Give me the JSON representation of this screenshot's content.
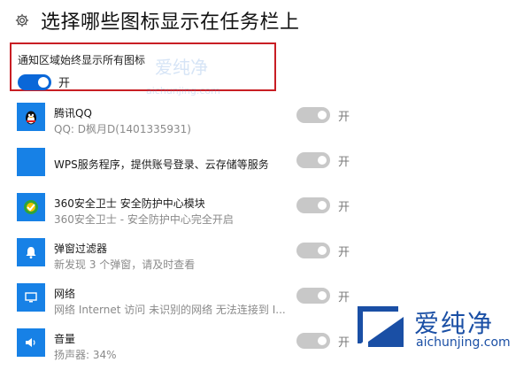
{
  "header": {
    "icon": "gear-icon",
    "title": "选择哪些图标显示在任务栏上"
  },
  "always_show": {
    "label": "通知区域始终显示所有图标",
    "state": "开",
    "on": true,
    "accent": "#0a67d8",
    "highlight_border": "#c81e24"
  },
  "apps": [
    {
      "name": "腾讯QQ",
      "sub": "QQ: D枫月D(1401335931)",
      "icon": "qq-penguin-icon",
      "state": "开"
    },
    {
      "name": "WPS服务程序，提供账号登录、云存储等服务",
      "sub": "",
      "icon": "wps-blank-icon",
      "state": "开"
    },
    {
      "name": "360安全卫士 安全防护中心模块",
      "sub": "360安全卫士 - 安全防护中心完全开启",
      "icon": "360-shield-icon",
      "state": "开"
    },
    {
      "name": "弹窗过滤器",
      "sub": "新发现 3 个弹窗，请及时查看",
      "icon": "bell-icon",
      "state": "开"
    },
    {
      "name": "网络",
      "sub": "网络 Internet 访问  未识别的网络 无法连接到 I...",
      "icon": "monitor-icon",
      "state": "开"
    },
    {
      "name": "音量",
      "sub": "扬声器: 34%",
      "icon": "speaker-icon",
      "state": "开"
    }
  ],
  "watermark": {
    "top_text": "爱纯净",
    "top_url": "aichunjing.com",
    "brand_text": "爱纯净",
    "brand_url": "aichunjing.com"
  }
}
